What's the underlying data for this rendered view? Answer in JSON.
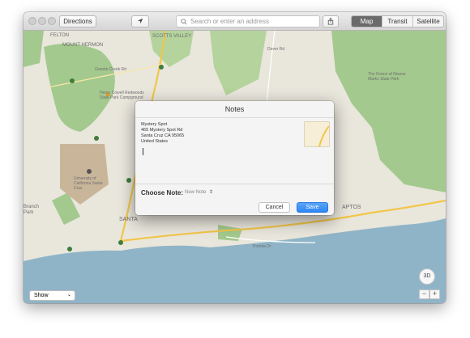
{
  "toolbar": {
    "directions_label": "Directions",
    "search_placeholder": "Search or enter an address",
    "map_modes": [
      "Map",
      "Transit",
      "Satellite"
    ],
    "active_mode": "Map"
  },
  "map": {
    "labels": {
      "felton": "FELTON",
      "mount_hermon": "MOUNT HERMON",
      "scotts_valley": "SCOTTS VALLEY",
      "henry_cowell": "Henry Cowell Redwoods State Park Campground",
      "forest_nisene": "The Forest of Nisene Marks State Park",
      "uc_santa_cruz": "University of California Santa Cruz",
      "santa": "SANTA",
      "aptos": "APTOS",
      "branch": "Branch",
      "park": "Park",
      "portola": "Portola Dr",
      "dover": "Dover Rd",
      "granite_creek": "Granite Creek Rd"
    }
  },
  "dialog": {
    "title": "Notes",
    "address_lines": [
      "Mystery Spot",
      "465 Mystery Spot Rd",
      "Santa Cruz CA 95065",
      "United States"
    ],
    "choose_note_label": "Choose Note:",
    "choose_note_value": "New Note",
    "cancel_label": "Cancel",
    "save_label": "Save"
  },
  "controls": {
    "show_label": "Show",
    "compass_label": "3D",
    "zoom_out": "−",
    "zoom_in": "+"
  },
  "colors": {
    "map_background": "#e9e6dc",
    "park_green": "#a3c98e",
    "water_blue": "#8fb4c7",
    "highway_yellow": "#f2c64a",
    "save_button_blue": "#2f86f4"
  }
}
